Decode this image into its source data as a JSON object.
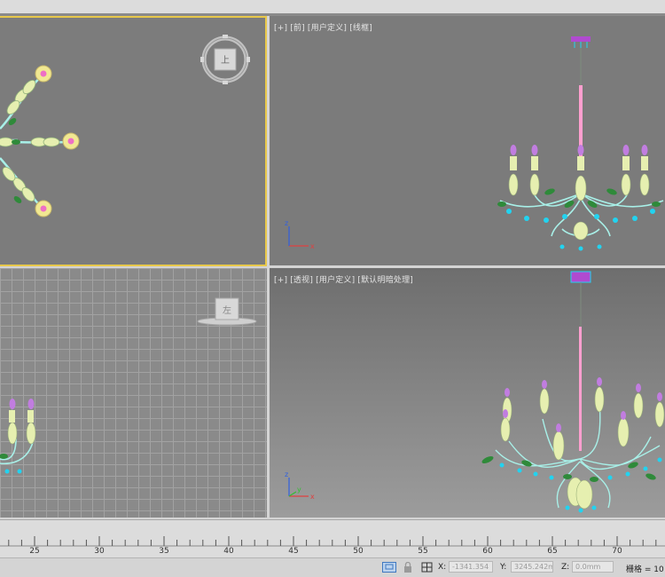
{
  "viewports": {
    "top_right": {
      "label": "[+] [前] [用户定义] [线框]"
    },
    "bottom_right": {
      "label": "[+] [透视] [用户定义] [默认明暗处理]"
    },
    "bottom_left": {
      "viewcube_label": "左"
    }
  },
  "timeline": {
    "ticks": [
      "25",
      "30",
      "35",
      "40",
      "45",
      "50",
      "55",
      "60",
      "65",
      "70"
    ]
  },
  "statusbar": {
    "x_label": "X:",
    "x_value": "-1341.354",
    "y_label": "Y:",
    "y_value": "3245.242m",
    "z_label": "Z:",
    "z_value": "0.0mm",
    "grid_text": "栅格 = 10"
  },
  "colors": {
    "active_border": "#e8c84a",
    "axis_x": "#e04040",
    "axis_y": "#30c030",
    "axis_z": "#3060e0",
    "chain": "#ff9fcf",
    "frame": "#a8f0e8",
    "leaf": "#2f8a3a",
    "candle": "#e6efb0",
    "flame": "#c17de0",
    "crystal": "#22d3f0",
    "flower": "#f1e892",
    "flower_center": "#ee6fc5"
  }
}
